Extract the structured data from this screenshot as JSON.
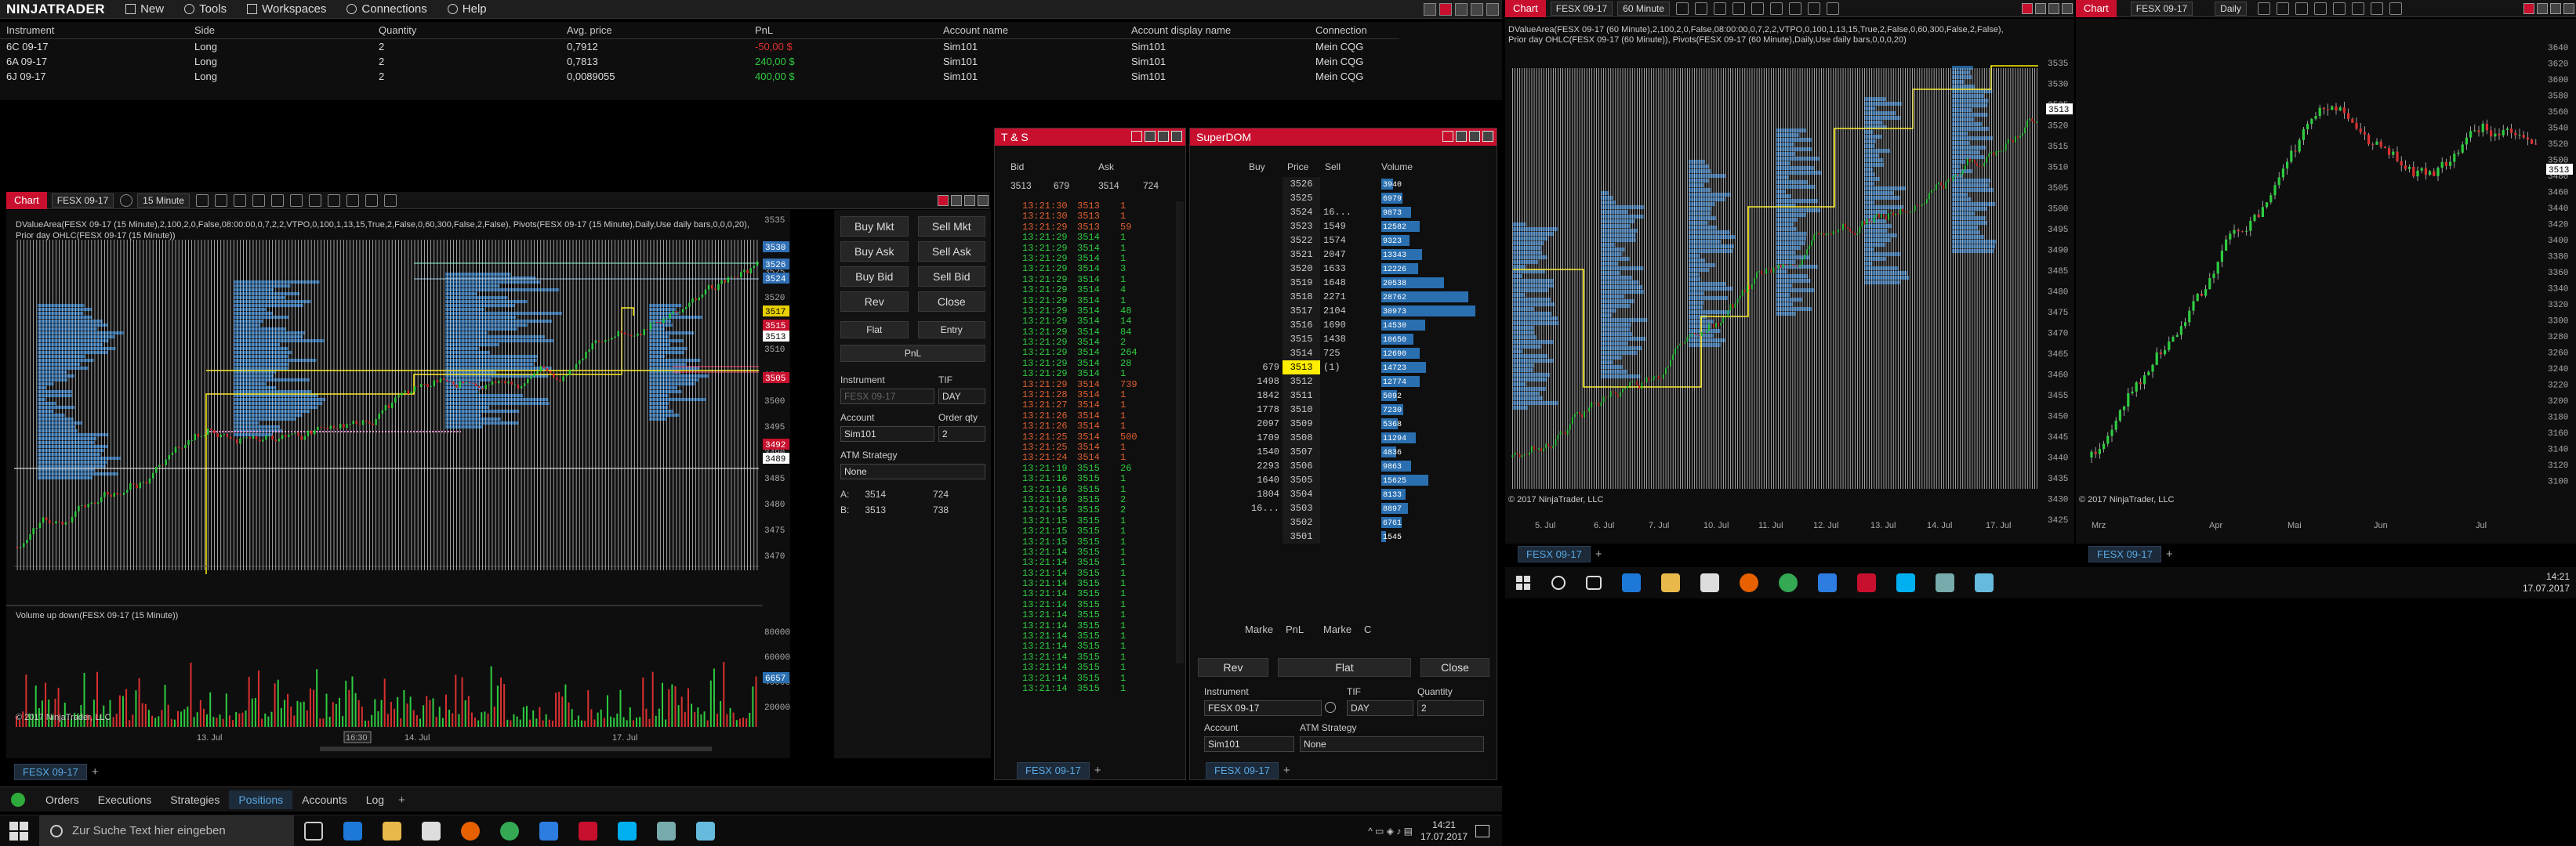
{
  "app": {
    "brand": "NINJATRADER"
  },
  "menu": [
    {
      "label": "New",
      "icon": "new-icon"
    },
    {
      "label": "Tools",
      "icon": "tools-icon"
    },
    {
      "label": "Workspaces",
      "icon": "workspaces-icon"
    },
    {
      "label": "Connections",
      "icon": "connections-icon"
    },
    {
      "label": "Help",
      "icon": "help-icon"
    }
  ],
  "positions": {
    "headers": [
      "Instrument",
      "Side",
      "Quantity",
      "Avg. price",
      "PnL",
      "Account name",
      "Account display name",
      "Connection"
    ],
    "rows": [
      {
        "instrument": "6C 09-17",
        "side": "Long",
        "qty": "2",
        "avg": "0,7912",
        "pnl": "-50,00 $",
        "account": "Sim101",
        "display": "Sim101",
        "conn": "Mein CQG"
      },
      {
        "instrument": "6A 09-17",
        "side": "Long",
        "qty": "2",
        "avg": "0,7813",
        "pnl": "240,00 $",
        "account": "Sim101",
        "display": "Sim101",
        "conn": "Mein CQG"
      },
      {
        "instrument": "6J 09-17",
        "side": "Long",
        "qty": "2",
        "avg": "0,0089055",
        "pnl": "400,00 $",
        "account": "Sim101",
        "display": "Sim101",
        "conn": "Mein CQG"
      }
    ]
  },
  "chart1": {
    "label": "Chart",
    "instrument": "FESX 09-17",
    "interval": "15 Minute",
    "indicators": "DValueArea(FESX 09-17 (15 Minute),2,100,2,0,False,08:00:00,0,7,2,2,VTPO,0,100,1,13,15,True,2,False,0,60,300,False,2,False), Pivots(FESX 09-17 (15 Minute),Daily,Use daily bars,0,0,0,20), Prior day OHLC(FESX 09-17 (15 Minute))",
    "volume_label": "Volume up down(FESX 09-17 (15 Minute))",
    "copyright": "© 2017 NinjaTrader, LLC",
    "y_ticks": [
      "3535",
      "3530",
      "3525",
      "3520",
      "3515",
      "3510",
      "3505",
      "3500",
      "3495",
      "3490",
      "3485",
      "3480",
      "3475",
      "3470"
    ],
    "vol_ticks": [
      "80000",
      "60000",
      "40000",
      "20000"
    ],
    "x_ticks": [
      "13. Jul",
      "16:30",
      "14. Jul",
      "17. Jul"
    ],
    "price_tags": [
      {
        "v": "3530",
        "c": "#2f6fb5"
      },
      {
        "v": "3526",
        "c": "#2f6fb5"
      },
      {
        "v": "3524",
        "c": "#2f6fb5"
      },
      {
        "v": "3517",
        "c": "#e8d000"
      },
      {
        "v": "3515",
        "c": "#c8102e"
      },
      {
        "v": "3513",
        "c": "#ffffff"
      },
      {
        "v": "3505",
        "c": "#c8102e"
      },
      {
        "v": "3492",
        "c": "#c8102e"
      },
      {
        "v": "3489",
        "c": "#ffffff"
      }
    ],
    "vol_tag": "6657",
    "tab": "FESX 09-17"
  },
  "chart_trader": {
    "buttons": [
      "Buy Mkt",
      "Sell Mkt",
      "Buy Ask",
      "Sell Ask",
      "Buy Bid",
      "Sell Bid",
      "Rev",
      "Close"
    ],
    "flat": "Flat",
    "entry": "Entry",
    "pnl": "PnL",
    "instrument_lbl": "Instrument",
    "instrument_val": "FESX 09-17",
    "tif_lbl": "TIF",
    "tif_val": "DAY",
    "account_lbl": "Account",
    "account_val": "Sim101",
    "qty_lbl": "Order qty",
    "qty_val": "2",
    "atm_lbl": "ATM Strategy",
    "atm_val": "None",
    "ask_row": [
      "A:",
      "3514",
      "724"
    ],
    "bid_row": [
      "B:",
      "3513",
      "738"
    ]
  },
  "ts": {
    "title": "T & S",
    "headers": [
      "Bid",
      "Ask"
    ],
    "top": [
      "3513",
      "679",
      "3514",
      "724"
    ],
    "rows": [
      [
        "13:21:30",
        "3513",
        "1",
        "r"
      ],
      [
        "13:21:30",
        "3513",
        "1",
        "r"
      ],
      [
        "13:21:29",
        "3513",
        "59",
        "r"
      ],
      [
        "13:21:29",
        "3514",
        "1",
        "g"
      ],
      [
        "13:21:29",
        "3514",
        "1",
        "g"
      ],
      [
        "13:21:29",
        "3514",
        "1",
        "g"
      ],
      [
        "13:21:29",
        "3514",
        "3",
        "g"
      ],
      [
        "13:21:29",
        "3514",
        "1",
        "g"
      ],
      [
        "13:21:29",
        "3514",
        "4",
        "g"
      ],
      [
        "13:21:29",
        "3514",
        "1",
        "g"
      ],
      [
        "13:21:29",
        "3514",
        "48",
        "g"
      ],
      [
        "13:21:29",
        "3514",
        "14",
        "g"
      ],
      [
        "13:21:29",
        "3514",
        "84",
        "g"
      ],
      [
        "13:21:29",
        "3514",
        "2",
        "g"
      ],
      [
        "13:21:29",
        "3514",
        "264",
        "g"
      ],
      [
        "13:21:29",
        "3514",
        "28",
        "g"
      ],
      [
        "13:21:29",
        "3514",
        "1",
        "g"
      ],
      [
        "13:21:29",
        "3514",
        "739",
        "r"
      ],
      [
        "13:21:28",
        "3514",
        "1",
        "r"
      ],
      [
        "13:21:27",
        "3514",
        "1",
        "r"
      ],
      [
        "13:21:26",
        "3514",
        "1",
        "r"
      ],
      [
        "13:21:26",
        "3514",
        "1",
        "r"
      ],
      [
        "13:21:25",
        "3514",
        "500",
        "r"
      ],
      [
        "13:21:25",
        "3514",
        "1",
        "r"
      ],
      [
        "13:21:24",
        "3514",
        "1",
        "r"
      ],
      [
        "13:21:19",
        "3515",
        "26",
        "g"
      ],
      [
        "13:21:16",
        "3515",
        "1",
        "g"
      ],
      [
        "13:21:16",
        "3515",
        "1",
        "g"
      ],
      [
        "13:21:16",
        "3515",
        "2",
        "g"
      ],
      [
        "13:21:15",
        "3515",
        "2",
        "g"
      ],
      [
        "13:21:15",
        "3515",
        "1",
        "g"
      ],
      [
        "13:21:15",
        "3515",
        "1",
        "g"
      ],
      [
        "13:21:15",
        "3515",
        "1",
        "g"
      ],
      [
        "13:21:14",
        "3515",
        "1",
        "g"
      ],
      [
        "13:21:14",
        "3515",
        "1",
        "g"
      ],
      [
        "13:21:14",
        "3515",
        "1",
        "g"
      ],
      [
        "13:21:14",
        "3515",
        "1",
        "g"
      ],
      [
        "13:21:14",
        "3515",
        "1",
        "g"
      ],
      [
        "13:21:14",
        "3515",
        "1",
        "g"
      ],
      [
        "13:21:14",
        "3515",
        "1",
        "g"
      ],
      [
        "13:21:14",
        "3515",
        "1",
        "g"
      ],
      [
        "13:21:14",
        "3515",
        "1",
        "g"
      ],
      [
        "13:21:14",
        "3515",
        "1",
        "g"
      ],
      [
        "13:21:14",
        "3515",
        "1",
        "g"
      ],
      [
        "13:21:14",
        "3515",
        "1",
        "g"
      ],
      [
        "13:21:14",
        "3515",
        "1",
        "g"
      ],
      [
        "13:21:14",
        "3515",
        "1",
        "g"
      ]
    ],
    "tab": "FESX 09-17"
  },
  "dom": {
    "title": "SuperDOM",
    "headers": [
      "Buy",
      "Price",
      "Sell",
      "Volume"
    ],
    "rows": [
      [
        "",
        "3526",
        "",
        "3940"
      ],
      [
        "",
        "3525",
        "",
        "6979"
      ],
      [
        "",
        "3524",
        "16...",
        "9873"
      ],
      [
        "",
        "3523",
        "1549",
        "12582"
      ],
      [
        "",
        "3522",
        "1574",
        "9323"
      ],
      [
        "",
        "3521",
        "2047",
        "13343"
      ],
      [
        "",
        "3520",
        "1633",
        "12226"
      ],
      [
        "",
        "3519",
        "1648",
        "20538"
      ],
      [
        "",
        "3518",
        "2271",
        "28762"
      ],
      [
        "",
        "3517",
        "2104",
        "30973"
      ],
      [
        "",
        "3516",
        "1690",
        "14530"
      ],
      [
        "",
        "3515",
        "1438",
        "10650"
      ],
      [
        "",
        "3514",
        "725",
        "12690"
      ],
      [
        "679",
        "3513",
        "(1)",
        "14723"
      ],
      [
        "1498",
        "3512",
        "",
        "12774"
      ],
      [
        "1842",
        "3511",
        "",
        "5092"
      ],
      [
        "1778",
        "3510",
        "",
        "7230"
      ],
      [
        "2097",
        "3509",
        "",
        "5368"
      ],
      [
        "1709",
        "3508",
        "",
        "11294"
      ],
      [
        "1540",
        "3507",
        "",
        "4836"
      ],
      [
        "2293",
        "3506",
        "",
        "9863"
      ],
      [
        "1640",
        "3505",
        "",
        "15625"
      ],
      [
        "1804",
        "3504",
        "",
        "8133"
      ],
      [
        "16...",
        "3503",
        "",
        "8897"
      ],
      [
        "",
        "3502",
        "",
        "6761"
      ],
      [
        "",
        "3501",
        "",
        "1545"
      ]
    ],
    "footer": [
      "Marke",
      "PnL",
      "Marke",
      "C"
    ],
    "rev": "Rev",
    "flat": "Flat",
    "close": "Close",
    "instrument_lbl": "Instrument",
    "instrument_val": "FESX 09-17",
    "tif_lbl": "TIF",
    "tif_val": "DAY",
    "qty_lbl": "Quantity",
    "qty_val": "2",
    "account_lbl": "Account",
    "account_val": "Sim101",
    "atm_lbl": "ATM Strategy",
    "atm_val": "None",
    "tab": "FESX 09-17"
  },
  "chart2": {
    "label": "Chart",
    "instrument": "FESX 09-17",
    "interval": "60 Minute",
    "indicators": "DValueArea(FESX 09-17 (60 Minute),2,100,2,0,False,08:00:00,0,7,2,2,VTPO,0,100,1,13,15,True,2,False,0,60,300,False,2,False), Prior day OHLC(FESX 09-17 (60 Minute)), Pivots(FESX 09-17 (60 Minute),Daily,Use daily bars,0,0,0,20)",
    "copyright": "© 2017 NinjaTrader, LLC",
    "y_ticks": [
      "3535",
      "3530",
      "3525",
      "3520",
      "3515",
      "3510",
      "3505",
      "3500",
      "3495",
      "3490",
      "3485",
      "3480",
      "3475",
      "3470",
      "3465",
      "3460",
      "3455",
      "3450",
      "3445",
      "3440",
      "3435",
      "3430",
      "3425"
    ],
    "x_ticks": [
      "5. Jul",
      "6. Jul",
      "7. Jul",
      "10. Jul",
      "11. Jul",
      "12. Jul",
      "13. Jul",
      "14. Jul",
      "17. Jul"
    ],
    "price_tag": "3513",
    "tab": "FESX 09-17"
  },
  "chart3": {
    "label": "Chart",
    "instrument": "FESX 09-17",
    "interval": "Daily",
    "copyright": "© 2017 NinjaTrader, LLC",
    "y_ticks": [
      "3640",
      "3620",
      "3600",
      "3580",
      "3560",
      "3540",
      "3520",
      "3500",
      "3480",
      "3460",
      "3440",
      "3420",
      "3400",
      "3380",
      "3360",
      "3340",
      "3320",
      "3300",
      "3280",
      "3260",
      "3240",
      "3220",
      "3200",
      "3180",
      "3160",
      "3140",
      "3120",
      "3100"
    ],
    "x_ticks": [
      "Mrz",
      "Apr",
      "Mai",
      "Jun",
      "Jul"
    ],
    "price_tag": "3513",
    "tab": "FESX 09-17"
  },
  "bottom_tabs": [
    "Orders",
    "Executions",
    "Strategies",
    "Positions",
    "Accounts",
    "Log"
  ],
  "taskbar_left": {
    "search_placeholder": "Zur Suche Text hier eingeben",
    "time": "14:21",
    "date": "17.07.2017"
  },
  "taskbar_right": {
    "time": "14:21",
    "date": "17.07.2017"
  }
}
